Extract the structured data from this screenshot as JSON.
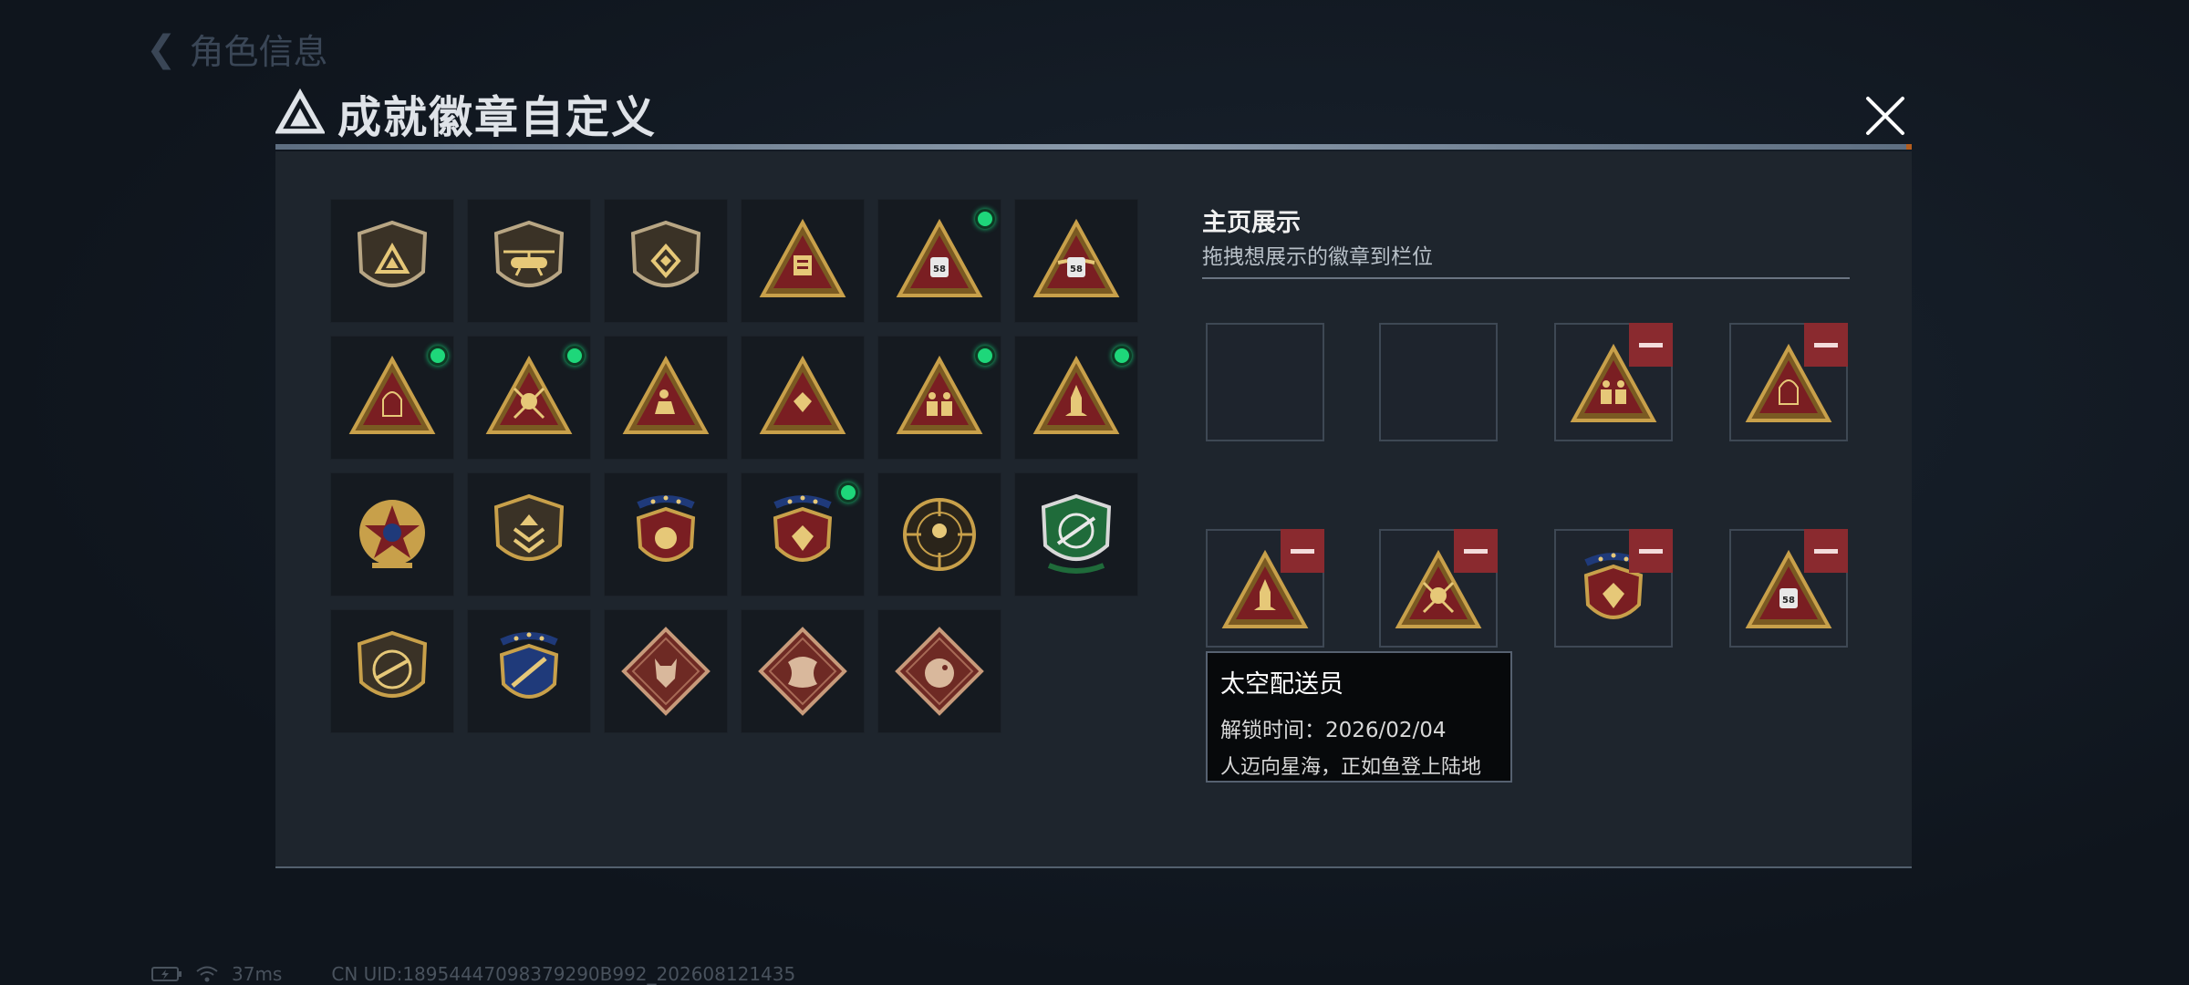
{
  "background": {
    "back_label": "角色信息",
    "back_icon": "back-arrow-icon"
  },
  "modal": {
    "title": "成就徽章自定义",
    "logo_icon": "delta-logo-icon",
    "close_icon": "close-icon"
  },
  "colors": {
    "panel": "#1e252d",
    "accent_green": "#1ed77a",
    "remove_red": "#8a2a2f",
    "gold": "#c8a04a"
  },
  "badges": [
    {
      "icon": "delta-shield-badge-icon",
      "equipped": false
    },
    {
      "icon": "helicopter-shield-badge-icon",
      "equipped": false
    },
    {
      "icon": "diamond-shield-badge-icon",
      "equipped": false
    },
    {
      "icon": "document-triangle-badge-icon",
      "equipped": false
    },
    {
      "icon": "astronaut-58-triangle-badge-icon",
      "equipped": true
    },
    {
      "icon": "winged-58-triangle-badge-icon",
      "equipped": false
    },
    {
      "icon": "hooded-figure-triangle-badge-icon",
      "equipped": true
    },
    {
      "icon": "skull-swords-triangle-badge-icon",
      "equipped": true
    },
    {
      "icon": "sitting-figure-triangle-badge-icon",
      "equipped": false
    },
    {
      "icon": "gem-triangle-badge-icon",
      "equipped": false
    },
    {
      "icon": "soldiers-triangle-badge-icon",
      "equipped": true
    },
    {
      "icon": "rocket-triangle-badge-icon",
      "equipped": true
    },
    {
      "icon": "star-medal-badge-icon",
      "equipped": false
    },
    {
      "icon": "chevron-shield-badge-icon",
      "equipped": false
    },
    {
      "icon": "laurel-shield-badge-icon",
      "equipped": false
    },
    {
      "icon": "gem-laurel-shield-badge-icon",
      "equipped": true
    },
    {
      "icon": "crosshair-round-badge-icon",
      "equipped": false
    },
    {
      "icon": "green-rifle-badge-icon",
      "equipped": false
    },
    {
      "icon": "rifle-shield-badge-icon",
      "equipped": false
    },
    {
      "icon": "sword-laurel-badge-icon",
      "equipped": false
    },
    {
      "icon": "wolf-diamond-badge-icon",
      "equipped": false
    },
    {
      "icon": "dragon-diamond-badge-icon",
      "equipped": false
    },
    {
      "icon": "serpent-diamond-badge-icon",
      "equipped": false
    }
  ],
  "showcase": {
    "title": "主页展示",
    "subtitle": "拖拽想展示的徽章到栏位",
    "remove_icon": "minus-icon",
    "slots": [
      {
        "filled": false,
        "icon": ""
      },
      {
        "filled": false,
        "icon": ""
      },
      {
        "filled": true,
        "icon": "soldiers-triangle-badge-icon"
      },
      {
        "filled": true,
        "icon": "hooded-figure-triangle-badge-icon"
      },
      {
        "filled": true,
        "icon": "rocket-triangle-badge-icon"
      },
      {
        "filled": true,
        "icon": "skull-swords-triangle-badge-icon"
      },
      {
        "filled": true,
        "icon": "gem-laurel-shield-badge-icon"
      },
      {
        "filled": true,
        "icon": "astronaut-58-triangle-badge-icon"
      }
    ]
  },
  "tooltip": {
    "name": "太空配送员",
    "unlock_time": "解锁时间：2026/02/04",
    "description": "人迈向星海，正如鱼登上陆地"
  },
  "status": {
    "ping": "37ms",
    "uid": "CN UID:18954447098379290B992_202608121435",
    "battery_icon": "battery-charging-icon",
    "wifi_icon": "wifi-icon"
  }
}
